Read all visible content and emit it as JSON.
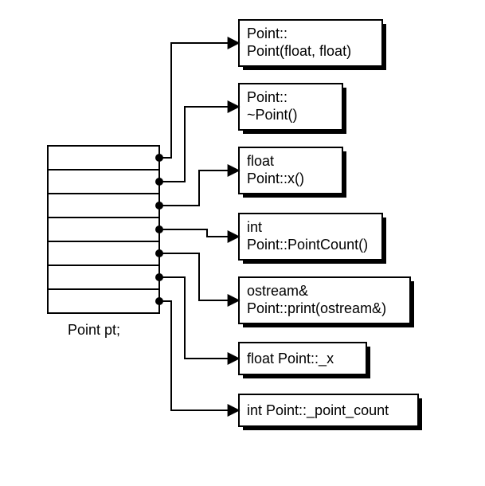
{
  "diagram": {
    "object_label": "Point pt;",
    "slot_count": 7,
    "boxes": [
      {
        "line1": "Point::",
        "line2": "Point(float, float)"
      },
      {
        "line1": "Point::",
        "line2": "~Point()"
      },
      {
        "line1": "float",
        "line2": "Point::x()"
      },
      {
        "line1": "int",
        "line2": "Point::PointCount()"
      },
      {
        "line1": "ostream&",
        "line2": "Point::print(ostream&)"
      },
      {
        "line1": "float Point::_x",
        "line2": ""
      },
      {
        "line1": "int Point::_point_count",
        "line2": ""
      }
    ]
  }
}
